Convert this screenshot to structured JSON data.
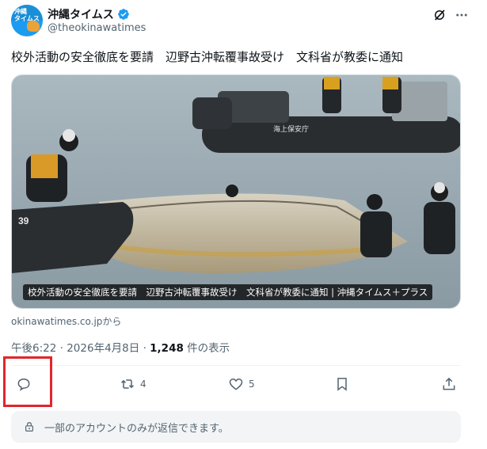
{
  "account": {
    "display_name": "沖縄タイムス",
    "handle": "@theokinawatimes",
    "avatar_text": "沖縄\nタイムス"
  },
  "tweet": {
    "text": "校外活動の安全徹底を要請　辺野古沖転覆事故受け　文科省が教委に通知",
    "media_caption": "校外活動の安全徹底を要請　辺野古沖転覆事故受け　文科省が教委に通知 | 沖縄タイムス＋プラス",
    "boat_text": "海上保安庁",
    "boat_number": "39",
    "source": "okinawatimes.co.jpから",
    "time": "午後6:22",
    "date": "2026年4月8日",
    "views_count": "1,248",
    "views_label": "件の表示"
  },
  "actions": {
    "reply_count": "",
    "retweet_count": "4",
    "like_count": "5"
  },
  "reply_notice": "一部のアカウントのみが返信できます。",
  "colors": {
    "accent": "#1d9bf0",
    "highlight_box": "#e0262a",
    "secondary_text": "#536471"
  }
}
